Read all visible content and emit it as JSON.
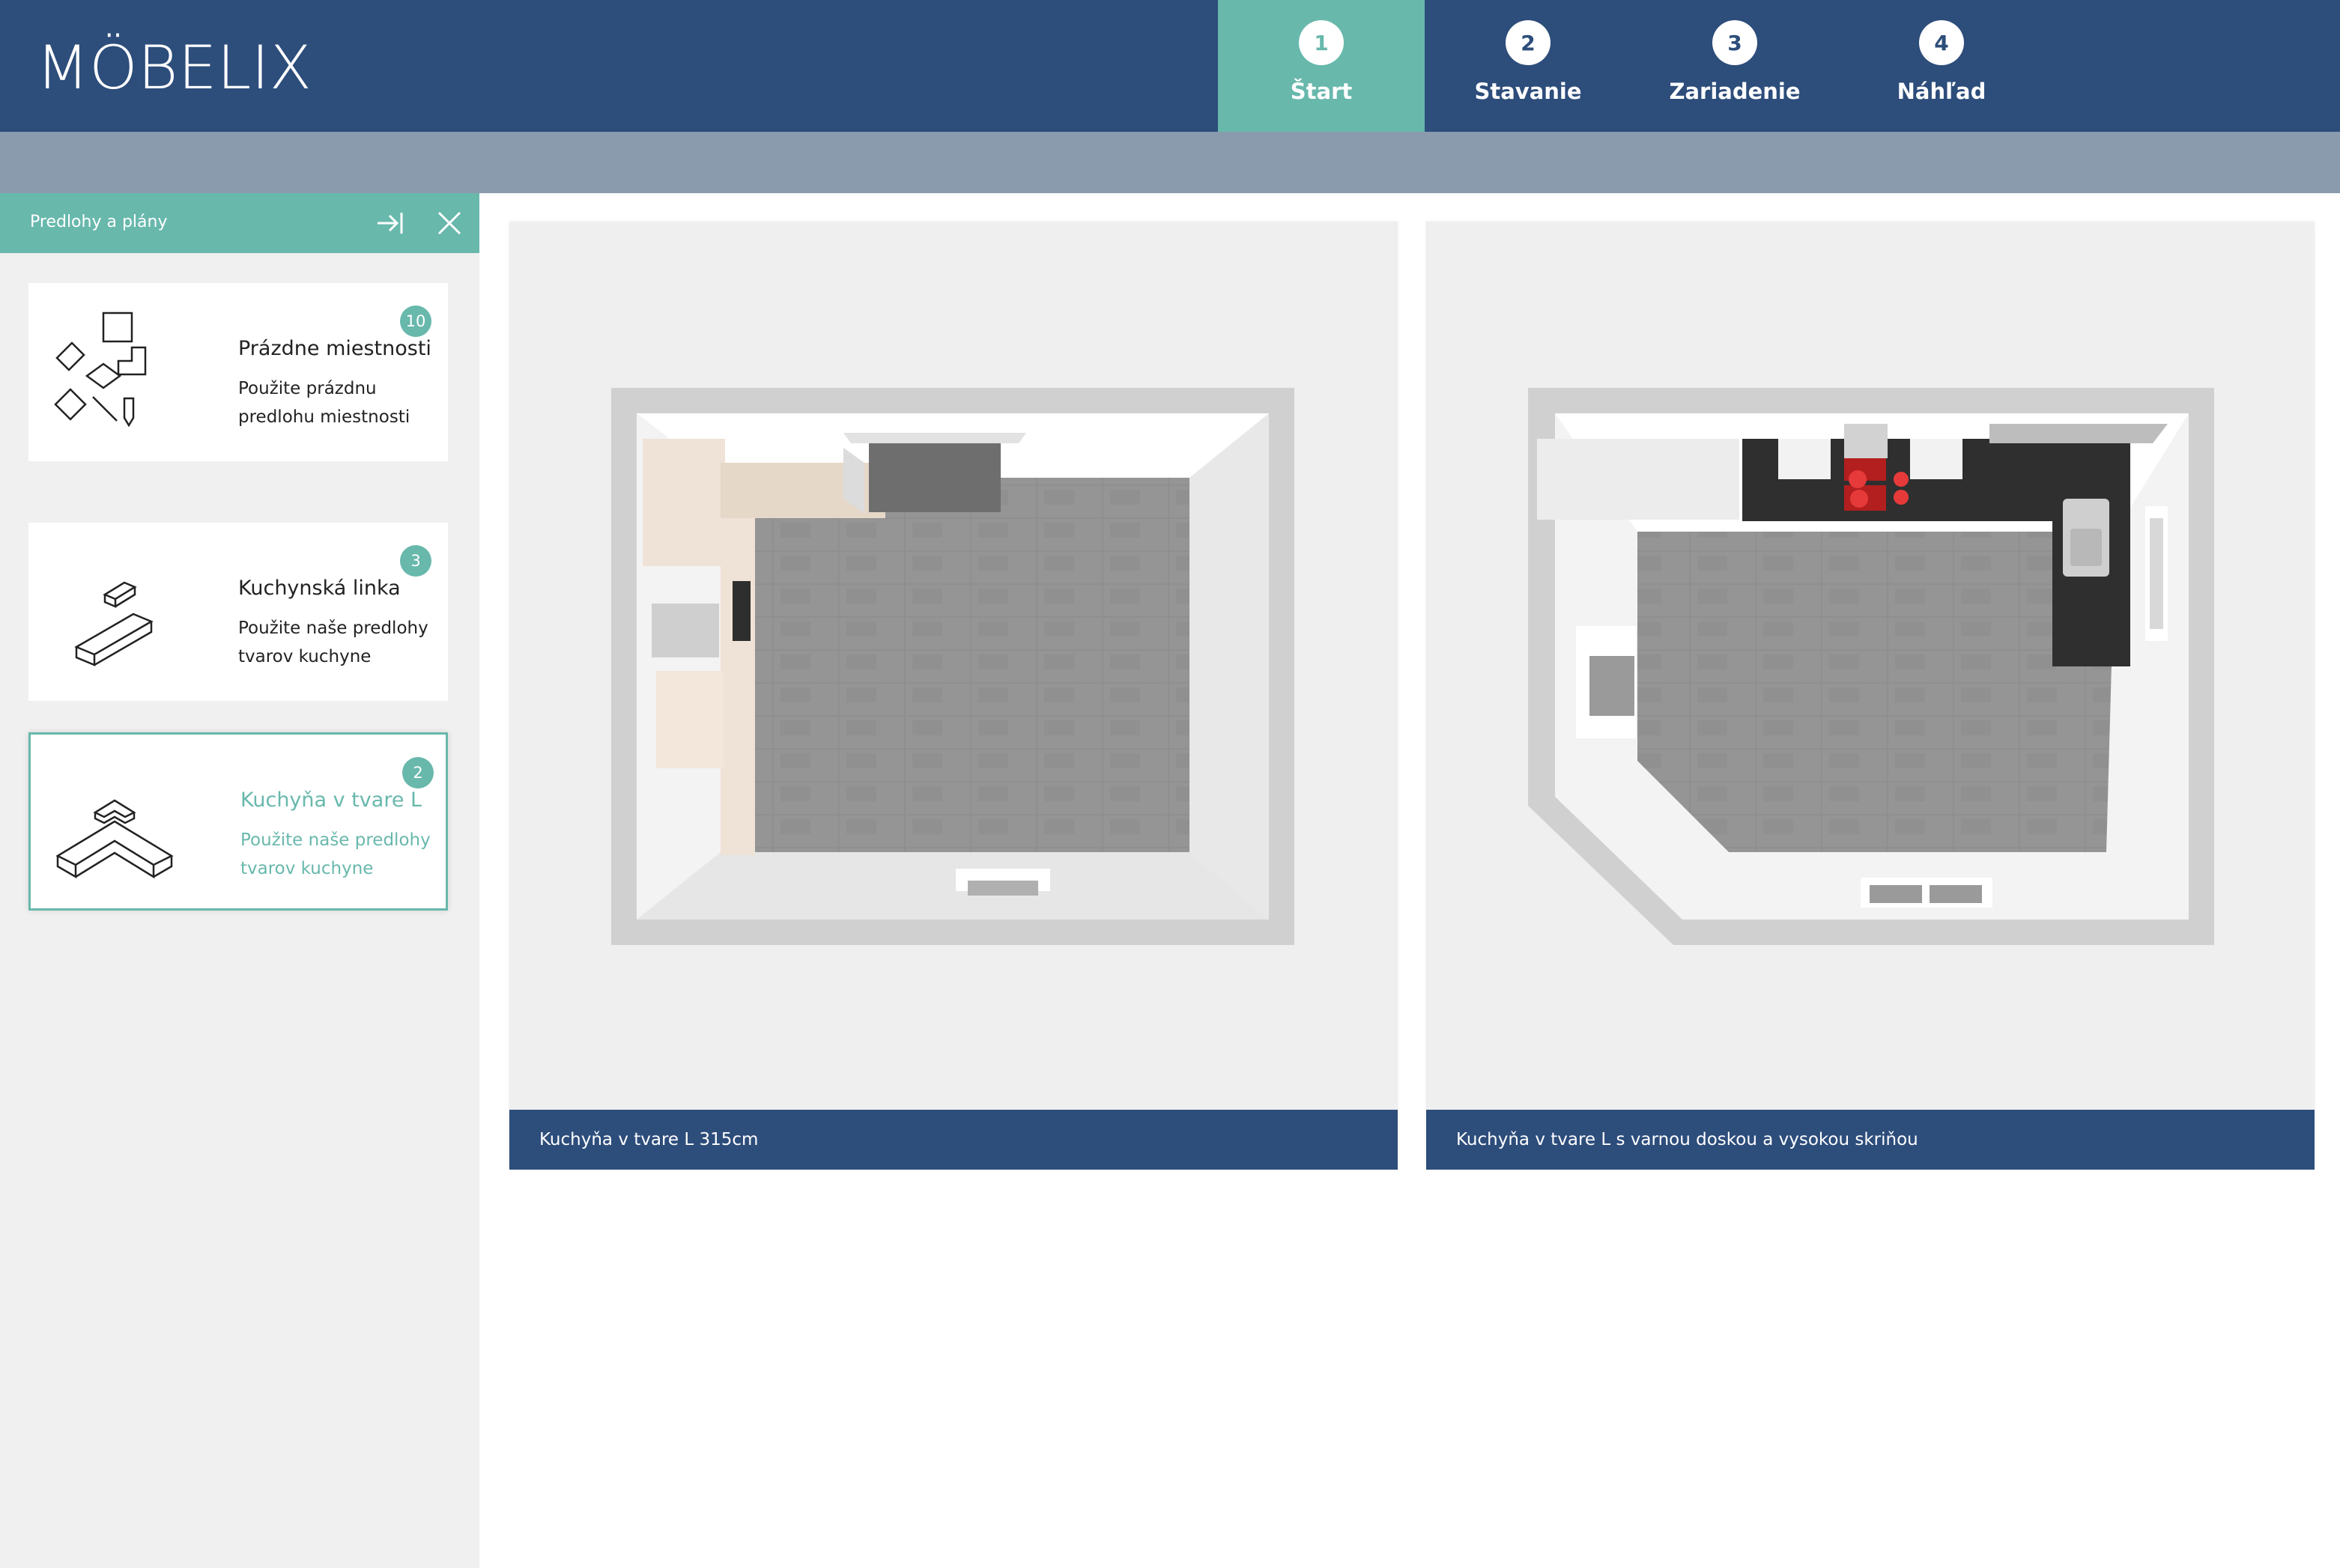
{
  "app": {
    "logo_text": "MÖBELIX",
    "colors": {
      "navy": "#2d4d7b",
      "teal": "#68b8ac",
      "subbar": "#8a9bad",
      "panel": "#f0f0f0"
    }
  },
  "steps": [
    {
      "number": "1",
      "label": "Štart",
      "active": true
    },
    {
      "number": "2",
      "label": "Stavanie",
      "active": false
    },
    {
      "number": "3",
      "label": "Zariadenie",
      "active": false
    },
    {
      "number": "4",
      "label": "Náhľad",
      "active": false
    }
  ],
  "sidebar": {
    "title": "Predlohy a plány",
    "icons": {
      "collapse": "collapse-right-icon",
      "close": "close-icon"
    },
    "cards": [
      {
        "title": "Prázdne miestnosti",
        "description": "Použite prázdnu predlohu miestnosti",
        "count": "10",
        "icon": "room-shapes-icon",
        "active": false
      },
      {
        "title": "Kuchynská linka",
        "description": "Použite naše predlohy tvarov kuchyne",
        "count": "3",
        "icon": "kitchen-line-icon",
        "active": false
      },
      {
        "title": "Kuchyňa v tvare L",
        "description": "Použite naše predlohy tvarov kuchyne",
        "count": "2",
        "icon": "l-kitchen-icon",
        "active": true
      }
    ]
  },
  "plans": [
    {
      "caption": "Kuchyňa v tvare L 315cm",
      "image": "floor-plan-l-kitchen-rectangular-room"
    },
    {
      "caption": "Kuchyňa v tvare L s varnou doskou a vysokou skriňou",
      "image": "floor-plan-l-kitchen-beveled-room"
    }
  ]
}
